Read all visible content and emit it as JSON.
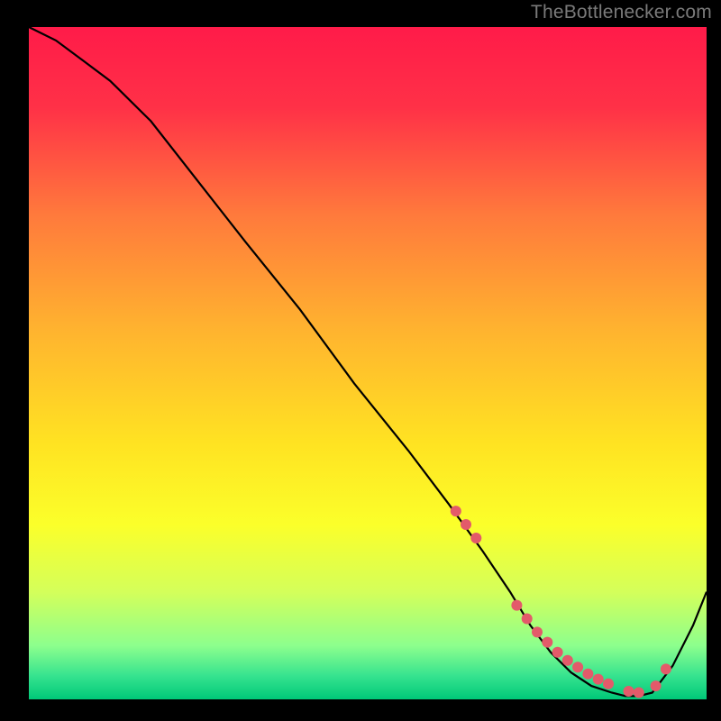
{
  "attribution": "TheBottlenecker.com",
  "chart_data": {
    "type": "line",
    "title": "",
    "xlabel": "",
    "ylabel": "",
    "xlim": [
      0,
      100
    ],
    "ylim": [
      0,
      100
    ],
    "grid": false,
    "legend": false,
    "background_gradient": {
      "stops": [
        {
          "offset": 0.0,
          "color": "#ff1b49"
        },
        {
          "offset": 0.12,
          "color": "#ff3147"
        },
        {
          "offset": 0.28,
          "color": "#ff7a3c"
        },
        {
          "offset": 0.45,
          "color": "#ffb32f"
        },
        {
          "offset": 0.62,
          "color": "#ffe322"
        },
        {
          "offset": 0.74,
          "color": "#fbff2a"
        },
        {
          "offset": 0.84,
          "color": "#d4ff5a"
        },
        {
          "offset": 0.92,
          "color": "#8dff8d"
        },
        {
          "offset": 0.965,
          "color": "#36e38f"
        },
        {
          "offset": 1.0,
          "color": "#00c878"
        }
      ]
    },
    "series": [
      {
        "name": "bottleneck-curve",
        "color": "#000000",
        "x": [
          0,
          4,
          8,
          12,
          18,
          25,
          32,
          40,
          48,
          56,
          62,
          67,
          71,
          74,
          77,
          80,
          83,
          86,
          88,
          90,
          92,
          95,
          98,
          100
        ],
        "y": [
          100,
          98,
          95,
          92,
          86,
          77,
          68,
          58,
          47,
          37,
          29,
          22,
          16,
          11,
          7,
          4,
          2,
          1,
          0.5,
          0.5,
          1,
          5,
          11,
          16
        ]
      }
    ],
    "marker_series": {
      "name": "highlight-points",
      "color": "#e35a6a",
      "radius": 6,
      "x": [
        63,
        64.5,
        66,
        72,
        73.5,
        75,
        76.5,
        78,
        79.5,
        81,
        82.5,
        84,
        85.5,
        88.5,
        90,
        92.5,
        94
      ],
      "y": [
        28,
        26,
        24,
        14,
        12,
        10,
        8.5,
        7,
        5.8,
        4.8,
        3.8,
        3,
        2.3,
        1.2,
        1,
        2,
        4.5
      ]
    }
  }
}
